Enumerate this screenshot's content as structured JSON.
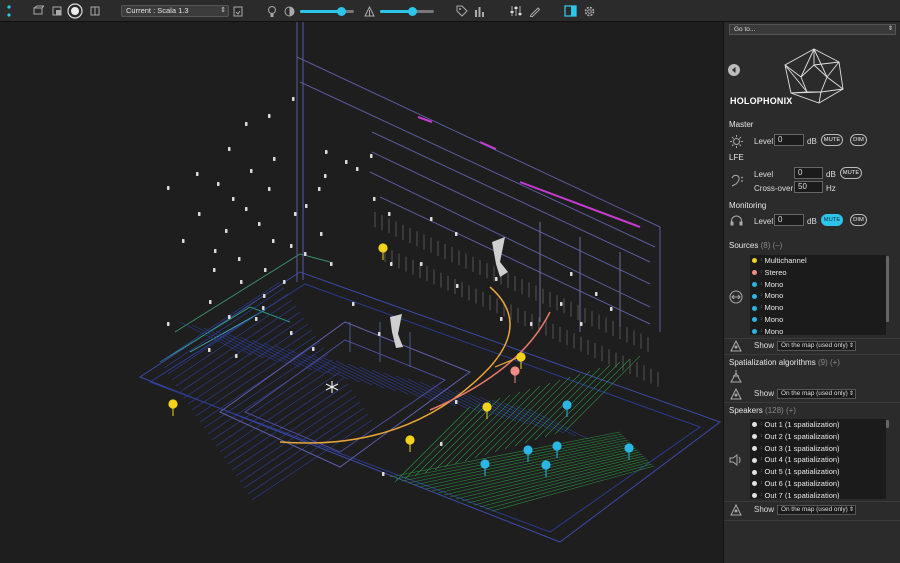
{
  "toolbar": {
    "preset_value": "Current : Scala 1.3",
    "slider1_level": 0.75,
    "slider2_level": 0.6,
    "accent": "#2ec5ea"
  },
  "panel": {
    "goto_placeholder": "Go to...",
    "brand": "HOLOPHONIX",
    "master": {
      "title": "Master",
      "level_label": "Level",
      "level_value": "0",
      "unit": "dB",
      "mute": "MUTE",
      "dim": "DIM"
    },
    "lfe": {
      "title": "LFE",
      "level_label": "Level",
      "level_value": "0",
      "unit": "dB",
      "mute": "MUTE",
      "crossover_label": "Cross-over",
      "crossover_value": "50",
      "crossover_unit": "Hz"
    },
    "monitoring": {
      "title": "Monitoring",
      "level_label": "Level",
      "level_value": "0",
      "unit": "dB",
      "mute": "MUTE",
      "dim": "DIM"
    },
    "sources": {
      "title": "Sources",
      "count": "(8)",
      "action": "(–)",
      "items": [
        {
          "label": "Multichannel",
          "color": "#f2d21b"
        },
        {
          "label": "Stereo",
          "color": "#f08c84"
        },
        {
          "label": "Mono",
          "color": "#2bb6e6"
        },
        {
          "label": "Mono",
          "color": "#2bb6e6"
        },
        {
          "label": "Mono",
          "color": "#2bb6e6"
        },
        {
          "label": "Mono",
          "color": "#2bb6e6"
        },
        {
          "label": "Mono",
          "color": "#2bb6e6"
        }
      ],
      "show_label": "Show",
      "show_value": "On the map (used only)"
    },
    "spatialization": {
      "title": "Spatialization algorithms",
      "count": "(9)",
      "action": "(+)",
      "show_label": "Show",
      "show_value": "On the map (used only)"
    },
    "speakers": {
      "title": "Speakers",
      "count": "(128)",
      "action": "(+)",
      "items": [
        {
          "label": "Out 1 (1 spatialization)"
        },
        {
          "label": "Out 2 (1 spatialization)"
        },
        {
          "label": "Out 3 (1 spatialization)"
        },
        {
          "label": "Out 4 (1 spatialization)"
        },
        {
          "label": "Out 5 (1 spatialization)"
        },
        {
          "label": "Out 6 (1 spatialization)"
        },
        {
          "label": "Out 7 (1 spatialization)"
        }
      ],
      "show_label": "Show",
      "show_value": "On the map (used only)"
    }
  },
  "map": {
    "markers": [
      {
        "color": "#f2d21b"
      },
      {
        "color": "#f2d21b"
      },
      {
        "color": "#f2d21b"
      },
      {
        "color": "#f2d21b"
      },
      {
        "color": "#f2d21b"
      },
      {
        "color": "#f08c84"
      },
      {
        "color": "#2bb6e6"
      },
      {
        "color": "#2bb6e6"
      },
      {
        "color": "#2bb6e6"
      },
      {
        "color": "#2bb6e6"
      },
      {
        "color": "#2bb6e6"
      },
      {
        "color": "#2bb6e6"
      }
    ]
  }
}
